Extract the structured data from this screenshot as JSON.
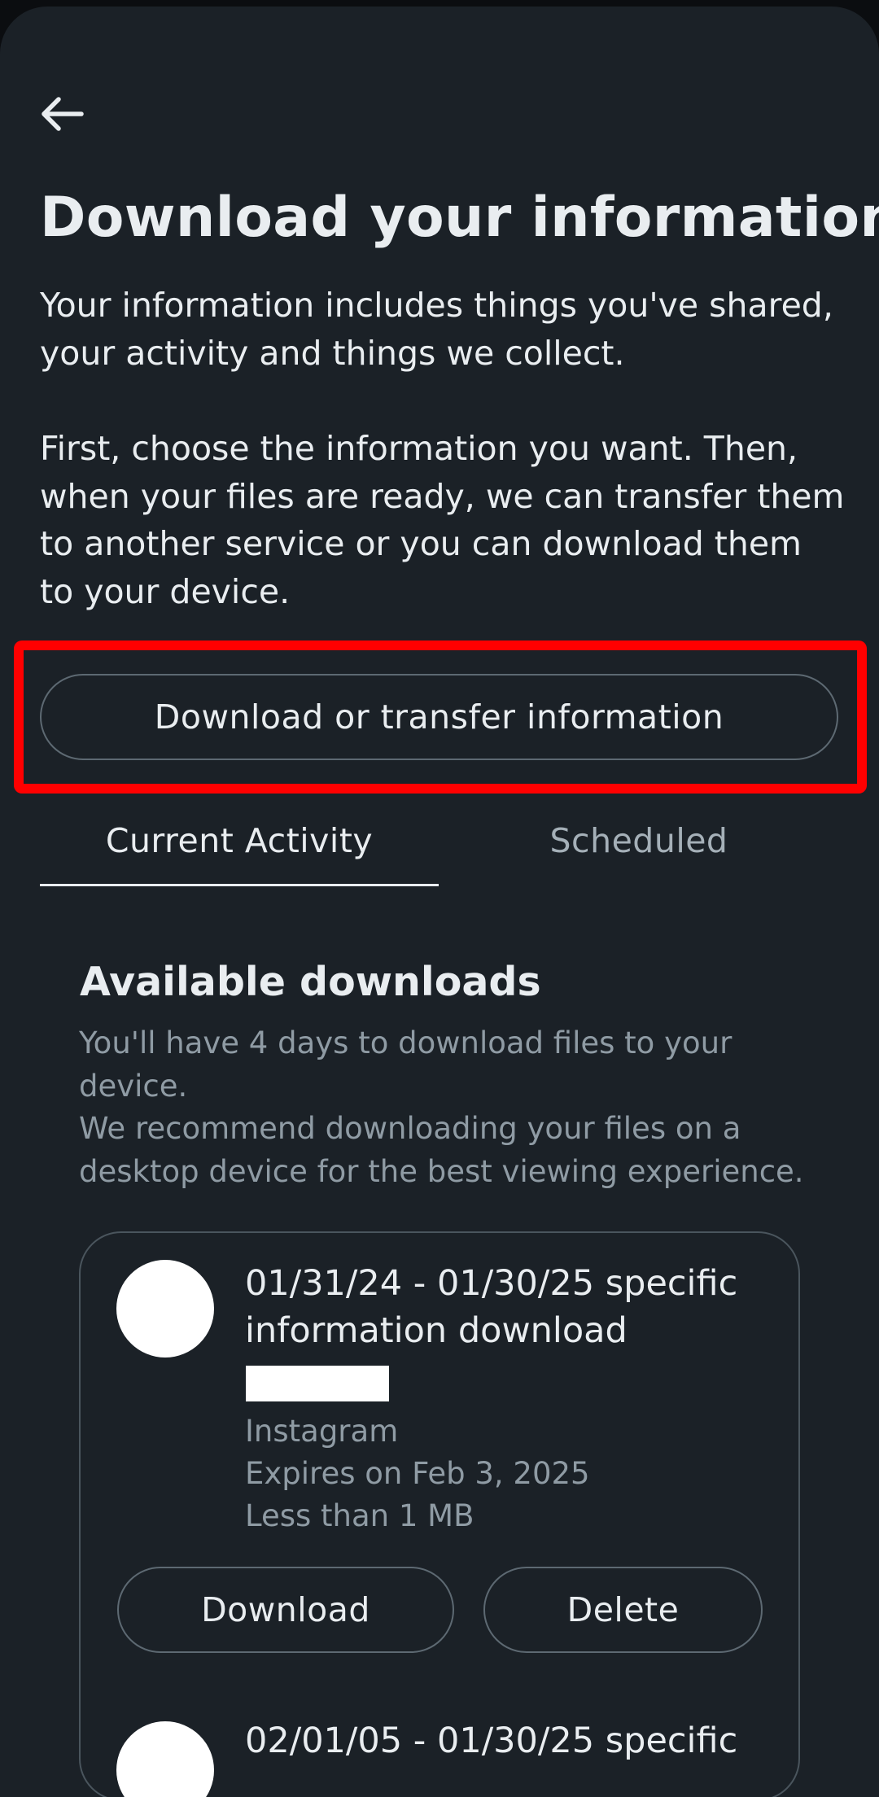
{
  "header": {
    "back_icon": "arrow-left-icon",
    "title": "Download your information"
  },
  "intro": {
    "paragraph1": "Your information includes things you've shared, your activity and things we collect.",
    "paragraph2": "First, choose the information you want. Then, when your files are ready, we can transfer them to another service or you can download them to your device."
  },
  "primary_action": {
    "label": "Download or transfer information",
    "highlight_color": "#ff0000"
  },
  "tabs": [
    {
      "label": "Current Activity",
      "active": true
    },
    {
      "label": "Scheduled",
      "active": false
    }
  ],
  "available_downloads": {
    "title": "Available downloads",
    "desc_line1": "You'll have 4 days to download files to your device.",
    "desc_line2": "We recommend downloading your files on a desktop device for the best viewing experience."
  },
  "downloads": [
    {
      "title": "01/31/24 - 01/30/25 specific information download",
      "app": "Instagram",
      "expires": "Expires on Feb 3, 2025",
      "size": "Less than 1 MB",
      "download_label": "Download",
      "delete_label": "Delete"
    },
    {
      "title": "02/01/05 - 01/30/25 specific"
    }
  ],
  "colors": {
    "background": "#1b2127",
    "text_primary": "#e9edf0",
    "text_secondary": "#8f9ba4",
    "border": "#5d6972"
  }
}
